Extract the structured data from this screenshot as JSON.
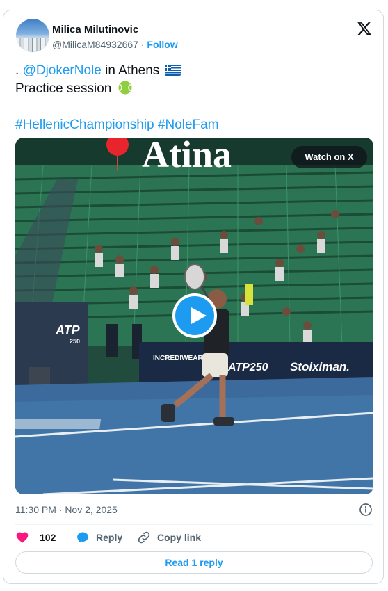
{
  "author": {
    "name": "Milica Milutinovic",
    "handle": "@MilicaM84932667",
    "separator": "·",
    "follow_label": "Follow"
  },
  "platform_icon": "x-logo-icon",
  "tweet": {
    "line1_prefix": ". ",
    "mention": "@DjokerNole",
    "line1_suffix": " in Athens",
    "flag_icon": "greece-flag-icon",
    "line2": "Practice session",
    "ball_icon": "tennis-ball-icon",
    "hashtag1": "#HellenicChampionship",
    "hashtag2": "#NoleFam"
  },
  "media": {
    "watch_label": "Watch on X",
    "overlay_text": "Atina",
    "banner_brands": [
      "INCREDIWEAR",
      "ATP250",
      "Stoiximan."
    ],
    "wall_logo": "ATP 250",
    "play_icon": "play-icon"
  },
  "timestamp": "11:30 PM · Nov 2, 2025",
  "actions": {
    "like_count": "102",
    "reply_label": "Reply",
    "copy_label": "Copy link"
  },
  "read_reply_label": "Read 1 reply",
  "colors": {
    "accent": "#1d9bf0",
    "like": "#f91880",
    "muted": "#536471",
    "border": "#cfd9de"
  }
}
